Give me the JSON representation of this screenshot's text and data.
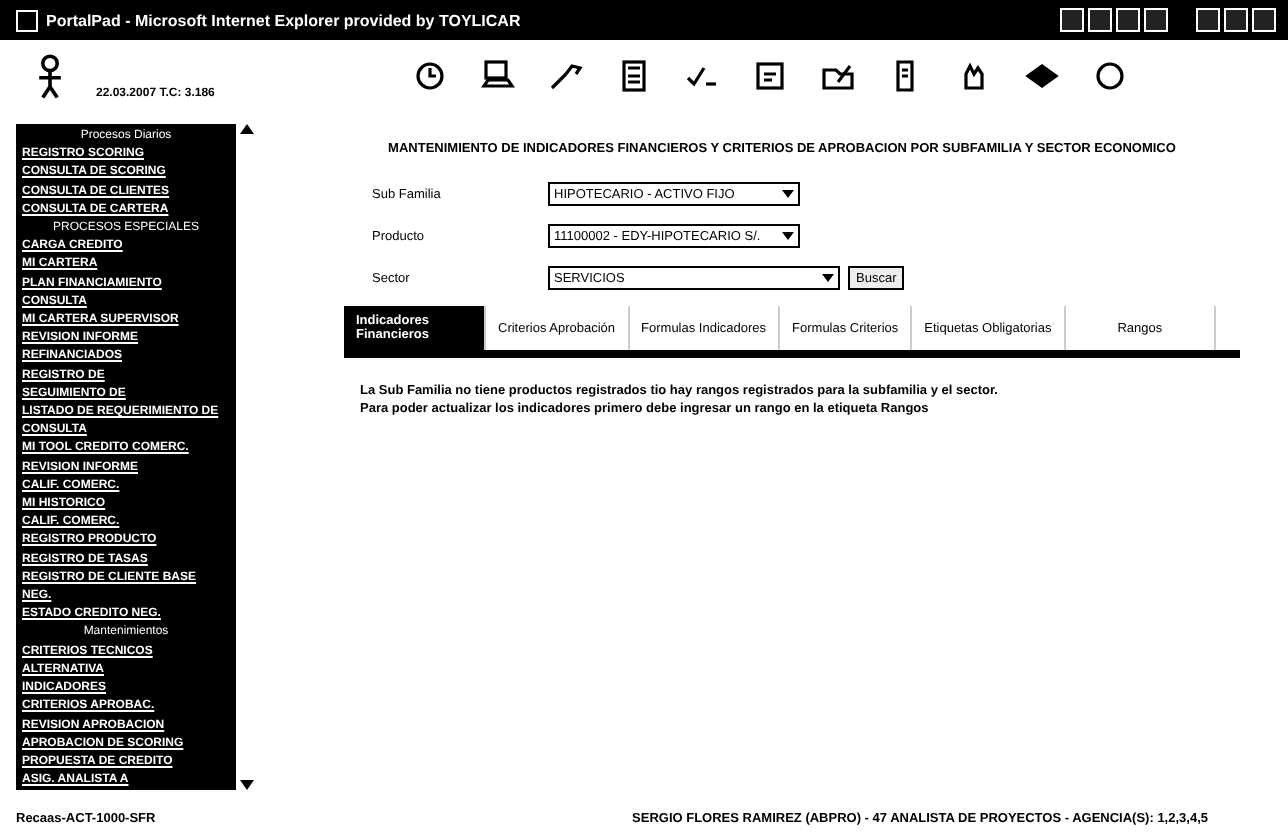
{
  "window": {
    "title": "PortalPad - Microsoft Internet Explorer provided by TOYLICAR"
  },
  "header": {
    "date": "22.03.2007 T.C: 3.186"
  },
  "sidebar": {
    "items": [
      {
        "kind": "heading",
        "label": "Procesos Diarios"
      },
      {
        "kind": "link",
        "label": "REGISTRO SCORING"
      },
      {
        "kind": "link",
        "label": "CONSULTA DE SCORING"
      },
      {
        "kind": "link",
        "label": "CONSULTA DE CLIENTES"
      },
      {
        "kind": "link",
        "label": "CONSULTA DE CARTERA"
      },
      {
        "kind": "heading",
        "label": "PROCESOS ESPECIALES"
      },
      {
        "kind": "link",
        "label": "CARGA CREDITO"
      },
      {
        "kind": "link",
        "label": "MI CARTERA"
      },
      {
        "kind": "link",
        "label": "PLAN FINANCIAMIENTO"
      },
      {
        "kind": "link",
        "label": "CONSULTA"
      },
      {
        "kind": "link",
        "label": "MI CARTERA SUPERVISOR"
      },
      {
        "kind": "link",
        "label": "REVISION INFORME"
      },
      {
        "kind": "link",
        "label": "REFINANCIADOS"
      },
      {
        "kind": "link",
        "label": "REGISTRO DE"
      },
      {
        "kind": "link",
        "label": "SEGUIMIENTO DE"
      },
      {
        "kind": "link",
        "label": "LISTADO DE REQUERIMIENTO DE"
      },
      {
        "kind": "link",
        "label": "CONSULTA"
      },
      {
        "kind": "link",
        "label": "MI TOOL CREDITO COMERC."
      },
      {
        "kind": "link",
        "label": "REVISION INFORME"
      },
      {
        "kind": "link",
        "label": "CALIF. COMERC."
      },
      {
        "kind": "link",
        "label": "MI HISTORICO"
      },
      {
        "kind": "link",
        "label": "CALIF. COMERC."
      },
      {
        "kind": "link",
        "label": "REGISTRO PRODUCTO"
      },
      {
        "kind": "link",
        "label": "REGISTRO DE TASAS"
      },
      {
        "kind": "link",
        "label": "REGISTRO DE CLIENTE BASE"
      },
      {
        "kind": "link",
        "label": "NEG."
      },
      {
        "kind": "link",
        "label": "ESTADO CREDITO NEG."
      },
      {
        "kind": "heading",
        "label": "Mantenimientos"
      },
      {
        "kind": "link",
        "label": "CRITERIOS TECNICOS"
      },
      {
        "kind": "link",
        "label": "ALTERNATIVA"
      },
      {
        "kind": "link",
        "label": "INDICADORES"
      },
      {
        "kind": "link",
        "label": "CRITERIOS APROBAC."
      },
      {
        "kind": "link",
        "label": "REVISION APROBACION"
      },
      {
        "kind": "link",
        "label": "APROBACION DE SCORING"
      },
      {
        "kind": "link",
        "label": "PROPUESTA DE CREDITO"
      },
      {
        "kind": "link",
        "label": "ASIG. ANALISTA A"
      }
    ]
  },
  "page": {
    "title": "MANTENIMIENTO DE INDICADORES FINANCIEROS Y CRITERIOS DE APROBACION POR SUBFAMILIA Y SECTOR ECONOMICO",
    "fields": [
      {
        "label": "Sub Familia",
        "value": "HIPOTECARIO - ACTIVO FIJO"
      },
      {
        "label": "Producto",
        "value": "11100002 - EDY-HIPOTECARIO S/."
      },
      {
        "label": "Sector",
        "value": "SERVICIOS"
      }
    ],
    "search_button": "Buscar",
    "tabs": [
      {
        "label": "Indicadores Financieros",
        "selected": true
      },
      {
        "label": "Criterios Aprobación",
        "selected": false
      },
      {
        "label": "Formulas Indicadores",
        "selected": false
      },
      {
        "label": "Formulas Criterios",
        "selected": false
      },
      {
        "label": "Etiquetas Obligatorias",
        "selected": false
      },
      {
        "label": "Rangos",
        "selected": false
      }
    ],
    "message": [
      "La Sub Familia no tiene productos registrados tio hay rangos registrados para la subfamilia y el sector.",
      "Para poder actualizar los indicadores primero debe ingresar un rango en la etiqueta Rangos"
    ]
  },
  "status_bar": {
    "left": "Recaas-ACT-1000-SFR",
    "user": "SERGIO FLORES RAMIREZ (ABPRO) - 47 ANALISTA DE PROYECTOS - AGENCIA(S): 1,2,3,4,5"
  }
}
